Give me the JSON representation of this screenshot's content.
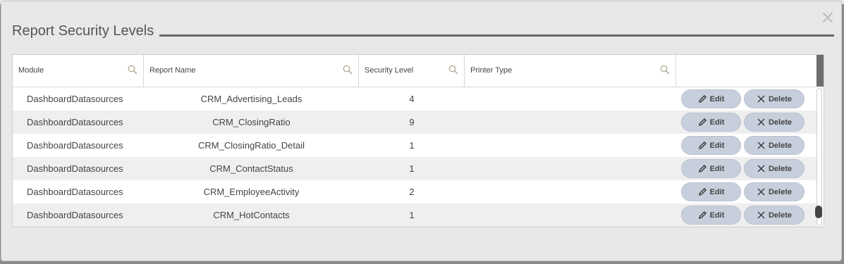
{
  "dialog": {
    "title": "Report Security Levels",
    "close_glyph": "×"
  },
  "columns": [
    {
      "label": "Module",
      "icon": "search-icon"
    },
    {
      "label": "Report Name",
      "icon": "search-icon"
    },
    {
      "label": "Security Level",
      "icon": "search-icon"
    },
    {
      "label": "Printer Type",
      "icon": "search-icon"
    },
    {
      "label": ""
    }
  ],
  "rows": [
    {
      "module": "DashboardDatasources",
      "report": "CRM_Advertising_Leads",
      "level": "4",
      "printer": ""
    },
    {
      "module": "DashboardDatasources",
      "report": "CRM_ClosingRatio",
      "level": "9",
      "printer": ""
    },
    {
      "module": "DashboardDatasources",
      "report": "CRM_ClosingRatio_Detail",
      "level": "1",
      "printer": ""
    },
    {
      "module": "DashboardDatasources",
      "report": "CRM_ContactStatus",
      "level": "1",
      "printer": ""
    },
    {
      "module": "DashboardDatasources",
      "report": "CRM_EmployeeActivity",
      "level": "2",
      "printer": ""
    },
    {
      "module": "DashboardDatasources",
      "report": "CRM_HotContacts",
      "level": "1",
      "printer": ""
    }
  ],
  "actions": {
    "edit_label": "Edit",
    "delete_label": "Delete"
  }
}
